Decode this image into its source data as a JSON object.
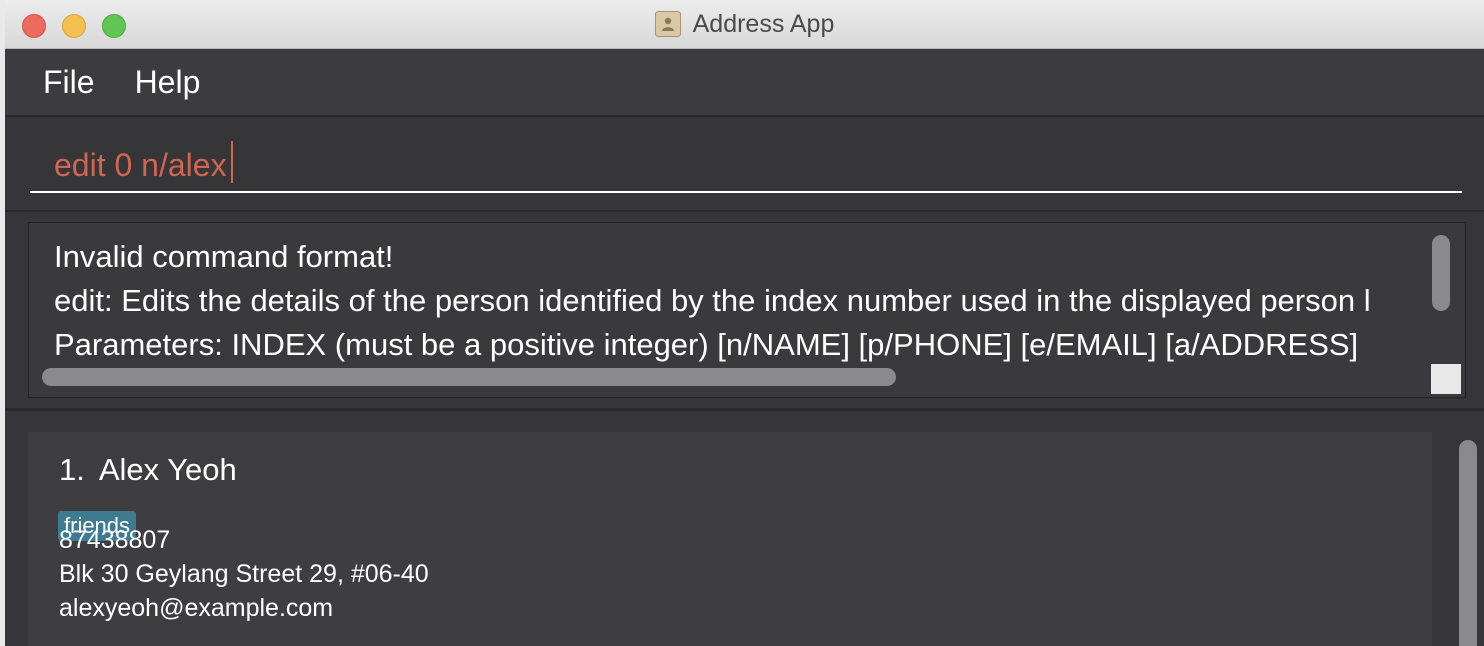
{
  "window": {
    "title": "Address App"
  },
  "menu": {
    "items": [
      {
        "label": "File"
      },
      {
        "label": "Help"
      }
    ]
  },
  "command_box": {
    "value": "edit 0 n/alex",
    "text_color": "#d06651"
  },
  "result_display": {
    "lines": [
      "Invalid command format!",
      "edit: Edits the details of the person identified by the index number used in the displayed person l",
      "Parameters: INDEX (must be a positive integer) [n/NAME] [p/PHONE] [e/EMAIL] [a/ADDRESS]"
    ]
  },
  "person_list": {
    "persons": [
      {
        "index": "1.",
        "name": "Alex Yeoh",
        "tags": [
          "friends"
        ],
        "phone": "87438807",
        "address": "Blk 30 Geylang Street 29, #06-40",
        "email": "alexyeoh@example.com"
      }
    ]
  },
  "colors": {
    "background": "#363638",
    "tag": "#3e7b91",
    "command_text": "#d06651"
  }
}
